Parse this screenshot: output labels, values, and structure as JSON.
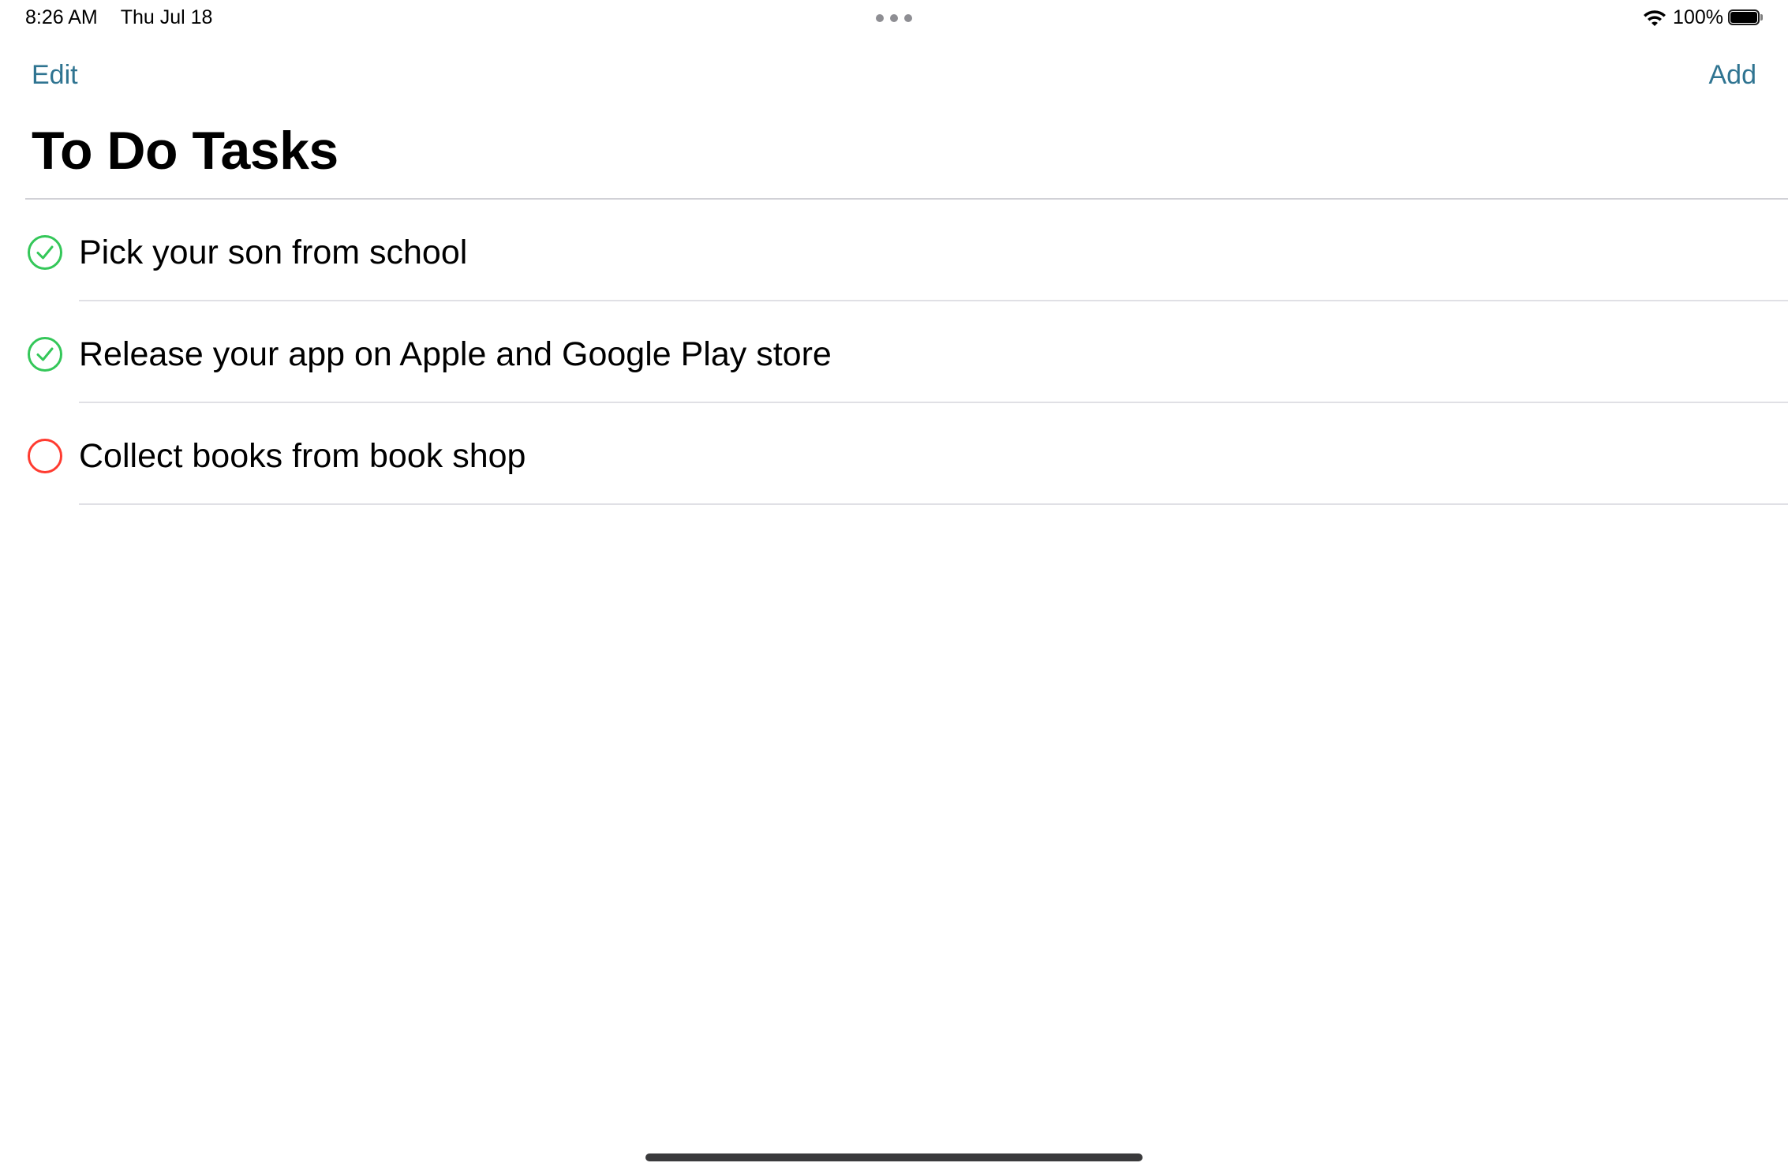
{
  "status_bar": {
    "time": "8:26 AM",
    "date": "Thu Jul 18",
    "battery_percent": "100%",
    "battery_level": 1.0,
    "wifi_icon": "wifi-icon",
    "battery_icon": "battery-icon"
  },
  "nav": {
    "edit_label": "Edit",
    "add_label": "Add",
    "accent_color": "#2f7491"
  },
  "page": {
    "title": "To Do Tasks"
  },
  "tasks": [
    {
      "label": "Pick your son from school",
      "completed": true,
      "icon": "check-circle-icon",
      "color": "#34c759"
    },
    {
      "label": "Release your app on Apple and Google Play store",
      "completed": true,
      "icon": "check-circle-icon",
      "color": "#34c759"
    },
    {
      "label": "Collect books from book shop",
      "completed": false,
      "icon": "empty-circle-icon",
      "color": "#ff3b30"
    }
  ]
}
